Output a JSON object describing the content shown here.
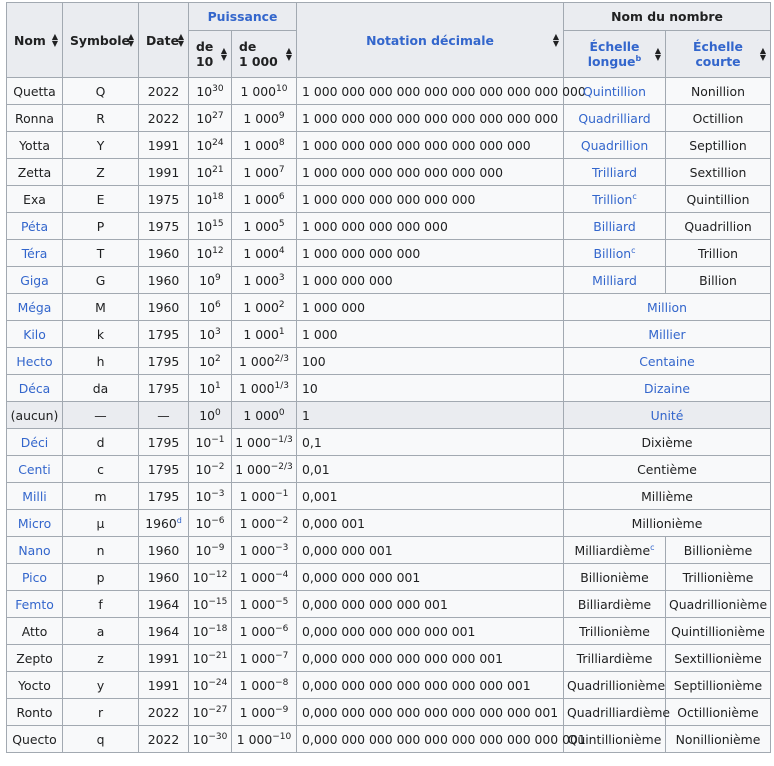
{
  "headers": {
    "nom": "Nom",
    "symbole": "Symbole",
    "date": "Date",
    "puissance": "Puissance",
    "de10": [
      "de",
      "10"
    ],
    "de1000": [
      "de",
      "1 000"
    ],
    "notation": "Notation décimale",
    "nom_nombre": "Nom du nombre",
    "echelle_longue": [
      "Échelle",
      "longue"
    ],
    "echelle_longue_ref": "b",
    "echelle_courte": [
      "Échelle",
      "courte"
    ]
  },
  "sort_icon": "sort-arrows-icon",
  "colors": {
    "link": "#3366cc",
    "header_bg": "#eaecf0",
    "cell_bg": "#f8f9fa",
    "border": "#a2a9b1"
  },
  "rows": [
    {
      "nom": "Quetta",
      "nom_link": false,
      "symbole": "Q",
      "date": "2022",
      "p10": "10",
      "e10": "30",
      "p1000": "1 000",
      "e1000": "10",
      "dec": "1 000 000 000 000 000 000 000 000 000 000",
      "longue": "Quintillion",
      "longue_link": true,
      "courte": "Nonillion"
    },
    {
      "nom": "Ronna",
      "nom_link": false,
      "symbole": "R",
      "date": "2022",
      "p10": "10",
      "e10": "27",
      "p1000": "1 000",
      "e1000": "9",
      "dec": "1 000 000 000 000 000 000 000 000 000",
      "longue": "Quadrilliard",
      "longue_link": true,
      "courte": "Octillion"
    },
    {
      "nom": "Yotta",
      "nom_link": false,
      "symbole": "Y",
      "date": "1991",
      "p10": "10",
      "e10": "24",
      "p1000": "1 000",
      "e1000": "8",
      "dec": "1 000 000 000 000 000 000 000 000",
      "longue": "Quadrillion",
      "longue_link": true,
      "courte": "Septillion"
    },
    {
      "nom": "Zetta",
      "nom_link": false,
      "symbole": "Z",
      "date": "1991",
      "p10": "10",
      "e10": "21",
      "p1000": "1 000",
      "e1000": "7",
      "dec": "1 000 000 000 000 000 000 000",
      "longue": "Trilliard",
      "longue_link": true,
      "courte": "Sextillion"
    },
    {
      "nom": "Exa",
      "nom_link": false,
      "symbole": "E",
      "date": "1975",
      "p10": "10",
      "e10": "18",
      "p1000": "1 000",
      "e1000": "6",
      "dec": "1 000 000 000 000 000 000",
      "longue": "Trillion",
      "longue_link": true,
      "longue_ref": "c",
      "courte": "Quintillion"
    },
    {
      "nom": "Péta",
      "nom_link": true,
      "symbole": "P",
      "date": "1975",
      "p10": "10",
      "e10": "15",
      "p1000": "1 000",
      "e1000": "5",
      "dec": "1 000 000 000 000 000",
      "longue": "Billiard",
      "longue_link": true,
      "courte": "Quadrillion"
    },
    {
      "nom": "Téra",
      "nom_link": true,
      "symbole": "T",
      "date": "1960",
      "p10": "10",
      "e10": "12",
      "p1000": "1 000",
      "e1000": "4",
      "dec": "1 000 000 000 000",
      "longue": "Billion",
      "longue_link": true,
      "longue_ref": "c",
      "courte": "Trillion"
    },
    {
      "nom": "Giga",
      "nom_link": true,
      "symbole": "G",
      "date": "1960",
      "p10": "10",
      "e10": "9",
      "p1000": "1 000",
      "e1000": "3",
      "dec": "1 000 000 000",
      "longue": "Milliard",
      "longue_link": true,
      "courte": "Billion"
    },
    {
      "nom": "Méga",
      "nom_link": true,
      "symbole": "M",
      "date": "1960",
      "p10": "10",
      "e10": "6",
      "p1000": "1 000",
      "e1000": "2",
      "dec": "1 000 000",
      "merged": "Million",
      "merged_link": true
    },
    {
      "nom": "Kilo",
      "nom_link": true,
      "symbole": "k",
      "date": "1795",
      "p10": "10",
      "e10": "3",
      "p1000": "1 000",
      "e1000": "1",
      "dec": "1 000",
      "merged": "Millier",
      "merged_link": true
    },
    {
      "nom": "Hecto",
      "nom_link": true,
      "symbole": "h",
      "date": "1795",
      "p10": "10",
      "e10": "2",
      "p1000": "1 000",
      "e1000": "2/3",
      "dec": "100",
      "merged": "Centaine",
      "merged_link": true
    },
    {
      "nom": "Déca",
      "nom_link": true,
      "symbole": "da",
      "date": "1795",
      "p10": "10",
      "e10": "1",
      "p1000": "1 000",
      "e1000": "1/3",
      "dec": "10",
      "merged": "Dizaine",
      "merged_link": true
    },
    {
      "nom": "(aucun)",
      "nom_link": false,
      "symbole": "—",
      "date": "—",
      "p10": "10",
      "e10": "0",
      "p1000": "1 000",
      "e1000": "0",
      "dec": "1",
      "merged": "Unité",
      "merged_link": true,
      "highlight": true
    },
    {
      "nom": "Déci",
      "nom_link": true,
      "symbole": "d",
      "date": "1795",
      "p10": "10",
      "e10": "−1",
      "p1000": "1 000",
      "e1000": "−1/3",
      "dec": "0,1",
      "merged": "Dixième",
      "merged_link": false
    },
    {
      "nom": "Centi",
      "nom_link": true,
      "symbole": "c",
      "date": "1795",
      "p10": "10",
      "e10": "−2",
      "p1000": "1 000",
      "e1000": "−2/3",
      "dec": "0,01",
      "merged": "Centième",
      "merged_link": false
    },
    {
      "nom": "Milli",
      "nom_link": true,
      "symbole": "m",
      "date": "1795",
      "p10": "10",
      "e10": "−3",
      "p1000": "1 000",
      "e1000": "−1",
      "dec": "0,001",
      "merged": "Millième",
      "merged_link": false
    },
    {
      "nom": "Micro",
      "nom_link": true,
      "symbole": "μ",
      "date": "1960",
      "date_ref": "d",
      "p10": "10",
      "e10": "−6",
      "p1000": "1 000",
      "e1000": "−2",
      "dec": "0,000 001",
      "merged": "Millionième",
      "merged_link": false
    },
    {
      "nom": "Nano",
      "nom_link": true,
      "symbole": "n",
      "date": "1960",
      "p10": "10",
      "e10": "−9",
      "p1000": "1 000",
      "e1000": "−3",
      "dec": "0,000 000 001",
      "longue": "Milliardième",
      "longue_link": false,
      "longue_ref": "c",
      "courte": "Billionième"
    },
    {
      "nom": "Pico",
      "nom_link": true,
      "symbole": "p",
      "date": "1960",
      "p10": "10",
      "e10": "−12",
      "p1000": "1 000",
      "e1000": "−4",
      "dec": "0,000 000 000 001",
      "longue": "Billionième",
      "longue_link": false,
      "courte": "Trillionième"
    },
    {
      "nom": "Femto",
      "nom_link": true,
      "symbole": "f",
      "date": "1964",
      "p10": "10",
      "e10": "−15",
      "p1000": "1 000",
      "e1000": "−5",
      "dec": "0,000 000 000 000 001",
      "longue": "Billiardième",
      "longue_link": false,
      "courte": "Quadrillionième"
    },
    {
      "nom": "Atto",
      "nom_link": false,
      "symbole": "a",
      "date": "1964",
      "p10": "10",
      "e10": "−18",
      "p1000": "1 000",
      "e1000": "−6",
      "dec": "0,000 000 000 000 000 001",
      "longue": "Trillionième",
      "longue_link": false,
      "courte": "Quintillionième"
    },
    {
      "nom": "Zepto",
      "nom_link": false,
      "symbole": "z",
      "date": "1991",
      "p10": "10",
      "e10": "−21",
      "p1000": "1 000",
      "e1000": "−7",
      "dec": "0,000 000 000 000 000 000 001",
      "longue": "Trilliardième",
      "longue_link": false,
      "courte": "Sextillionième"
    },
    {
      "nom": "Yocto",
      "nom_link": false,
      "symbole": "y",
      "date": "1991",
      "p10": "10",
      "e10": "−24",
      "p1000": "1 000",
      "e1000": "−8",
      "dec": "0,000 000 000 000 000 000 000 001",
      "longue": "Quadrillionième",
      "longue_link": false,
      "courte": "Septillionième"
    },
    {
      "nom": "Ronto",
      "nom_link": false,
      "symbole": "r",
      "date": "2022",
      "p10": "10",
      "e10": "−27",
      "p1000": "1 000",
      "e1000": "−9",
      "dec": "0,000 000 000 000 000 000 000 000 001",
      "longue": "Quadrilliardième",
      "longue_link": false,
      "courte": "Octillionième"
    },
    {
      "nom": "Quecto",
      "nom_link": false,
      "symbole": "q",
      "date": "2022",
      "p10": "10",
      "e10": "−30",
      "p1000": "1 000",
      "e1000": "−10",
      "dec": "0,000 000 000 000 000 000 000 000 000 001",
      "longue": "Quintillionième",
      "longue_link": false,
      "courte": "Nonillionième"
    }
  ]
}
